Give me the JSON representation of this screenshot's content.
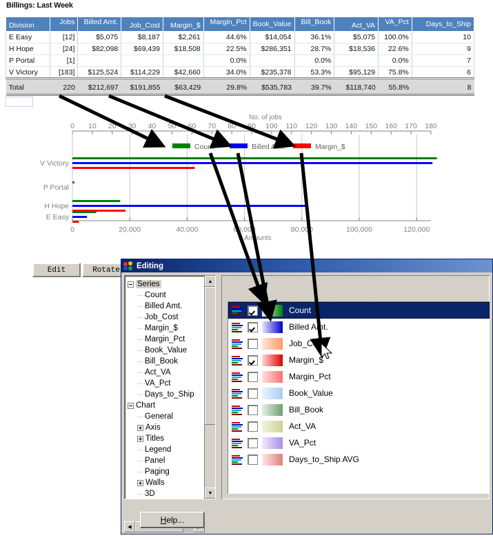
{
  "report": {
    "title": "Billings: Last Week"
  },
  "grid": {
    "columns": [
      "Division",
      "Jobs",
      "Billed Amt.",
      "Job_Cost",
      "Margin_$",
      "Margin_Pct",
      "Book_Value",
      "Bill_Book",
      "Act_VA",
      "VA_Pct",
      "Days_to_Ship"
    ],
    "rows": [
      {
        "division": "E Easy",
        "jobs": "[12]",
        "billed": "$5,075",
        "job_cost": "$8,187",
        "margin": "$2,261",
        "margin_pct": "44.6%",
        "book_value": "$14,054",
        "bill_book": "36.1%",
        "act_va": "$5,075",
        "va_pct": "100.0%",
        "days": "10"
      },
      {
        "division": "H Hope",
        "jobs": "[24]",
        "billed": "$82,098",
        "job_cost": "$69,439",
        "margin": "$18,508",
        "margin_pct": "22.5%",
        "book_value": "$286,351",
        "bill_book": "28.7%",
        "act_va": "$18,536",
        "va_pct": "22.6%",
        "days": "9"
      },
      {
        "division": "P Portal",
        "jobs": "[1]",
        "billed": "",
        "job_cost": "",
        "margin": "",
        "margin_pct": "0.0%",
        "book_value": "",
        "bill_book": "0.0%",
        "act_va": "",
        "va_pct": "0.0%",
        "days": "7"
      },
      {
        "division": "V Victory",
        "jobs": "[183]",
        "billed": "$125,524",
        "job_cost": "$114,229",
        "margin": "$42,660",
        "margin_pct": "34.0%",
        "book_value": "$235,378",
        "bill_book": "53.3%",
        "act_va": "$95,129",
        "va_pct": "75.8%",
        "days": "6"
      }
    ],
    "total": {
      "division": "Total",
      "jobs": "220",
      "billed": "$212,697",
      "job_cost": "$191,855",
      "margin": "$63,429",
      "margin_pct": "29.8%",
      "book_value": "$535,783",
      "bill_book": "39.7%",
      "act_va": "$118,740",
      "va_pct": "55.8%",
      "days": "8"
    },
    "highlighted_cell": "$286,351"
  },
  "chart_data": {
    "type": "bar",
    "orientation": "horizontal",
    "title": "",
    "categories": [
      "V Victory",
      "P Portal",
      "H Hope",
      "E Easy"
    ],
    "series": [
      {
        "name": "Count",
        "color": "#008000",
        "axis": "top",
        "values": [
          183,
          1,
          24,
          12
        ]
      },
      {
        "name": "Billed Amt.",
        "color": "#0000ff",
        "axis": "bottom",
        "values": [
          125524,
          0,
          82098,
          5075
        ]
      },
      {
        "name": "Margin_$",
        "color": "#ff0000",
        "axis": "bottom",
        "values": [
          42660,
          0,
          18508,
          2261
        ]
      }
    ],
    "top_axis": {
      "label": "No. of jobs",
      "ticks": [
        "0",
        "10",
        "20",
        "30",
        "40",
        "50",
        "60",
        "70",
        "80",
        "90",
        "100",
        "110",
        "120",
        "130",
        "140",
        "150",
        "160",
        "170",
        "180"
      ],
      "min": 0,
      "max": 180
    },
    "bottom_axis": {
      "label": "$ Amounts",
      "ticks": [
        "0",
        "20,000",
        "40,000",
        "60,000",
        "80,000",
        "100,000",
        "120,000"
      ],
      "min": 0,
      "max": 125000
    },
    "legend": {
      "position": "top",
      "entries": [
        {
          "label": "Count",
          "color": "#008000"
        },
        {
          "label": "Billed Amt.",
          "color": "#0000ff"
        },
        {
          "label": "Margin_$",
          "color": "#ff0000"
        }
      ]
    },
    "grid": true
  },
  "toolbar": {
    "edit_label": "Edit",
    "rotate_label": "Rotate"
  },
  "dialog": {
    "title": "Editing",
    "help_label_prefix": "H",
    "help_label_rest": "elp...",
    "tree": [
      {
        "label": "Series",
        "level": 1,
        "expander": "minus",
        "selected": true
      },
      {
        "label": "Count",
        "level": 2,
        "expander": "none",
        "selected": false
      },
      {
        "label": "Billed Amt.",
        "level": 2,
        "expander": "none",
        "selected": false
      },
      {
        "label": "Job_Cost",
        "level": 2,
        "expander": "none",
        "selected": false
      },
      {
        "label": "Margin_$",
        "level": 2,
        "expander": "none",
        "selected": false
      },
      {
        "label": "Margin_Pct",
        "level": 2,
        "expander": "none",
        "selected": false
      },
      {
        "label": "Book_Value",
        "level": 2,
        "expander": "none",
        "selected": false
      },
      {
        "label": "Bill_Book",
        "level": 2,
        "expander": "none",
        "selected": false
      },
      {
        "label": "Act_VA",
        "level": 2,
        "expander": "none",
        "selected": false
      },
      {
        "label": "VA_Pct",
        "level": 2,
        "expander": "none",
        "selected": false
      },
      {
        "label": "Days_to_Ship",
        "level": 2,
        "expander": "none",
        "selected": false
      },
      {
        "label": "Chart",
        "level": 1,
        "expander": "minus",
        "selected": false
      },
      {
        "label": "General",
        "level": 2,
        "expander": "none",
        "selected": false
      },
      {
        "label": "Axis",
        "level": 2,
        "expander": "plus",
        "selected": false
      },
      {
        "label": "Titles",
        "level": 2,
        "expander": "plus",
        "selected": false
      },
      {
        "label": "Legend",
        "level": 2,
        "expander": "none",
        "selected": false
      },
      {
        "label": "Panel",
        "level": 2,
        "expander": "none",
        "selected": false
      },
      {
        "label": "Paging",
        "level": 2,
        "expander": "none",
        "selected": false
      },
      {
        "label": "Walls",
        "level": 2,
        "expander": "plus",
        "selected": false
      },
      {
        "label": "3D",
        "level": 2,
        "expander": "none",
        "selected": false
      }
    ],
    "series_list": [
      {
        "label": "Count",
        "checked": true,
        "selected": true,
        "color_from": "#e8f5e8",
        "color_to": "#008000"
      },
      {
        "label": "Billed Amt.",
        "checked": true,
        "selected": false,
        "color_from": "#e8e8ff",
        "color_to": "#0000cc"
      },
      {
        "label": "Job_Cost",
        "checked": false,
        "selected": false,
        "color_from": "#ffe6d5",
        "color_to": "#ff9966"
      },
      {
        "label": "Margin_$",
        "checked": true,
        "selected": false,
        "color_from": "#ffd9d9",
        "color_to": "#e00000"
      },
      {
        "label": "Margin_Pct",
        "checked": false,
        "selected": false,
        "color_from": "#ffe0e0",
        "color_to": "#ff7070"
      },
      {
        "label": "Book_Value",
        "checked": false,
        "selected": false,
        "color_from": "#eaf4ff",
        "color_to": "#a8cdf0"
      },
      {
        "label": "Bill_Book",
        "checked": false,
        "selected": false,
        "color_from": "#e6f0e6",
        "color_to": "#6f9f6f"
      },
      {
        "label": "Act_VA",
        "checked": false,
        "selected": false,
        "color_from": "#f5f5e0",
        "color_to": "#cfcf9a"
      },
      {
        "label": "VA_Pct",
        "checked": false,
        "selected": false,
        "color_from": "#f0eaff",
        "color_to": "#a98fe0"
      },
      {
        "label": "Days_to_Ship AVG",
        "checked": false,
        "selected": false,
        "color_from": "#ffe8e8",
        "color_to": "#e08080"
      }
    ]
  },
  "colors": {
    "header_blue": "#4f81bd",
    "title_bar_blue": "#0a246a",
    "dialog_face": "#d4d0c8",
    "selection_blue": "#0a246a"
  }
}
